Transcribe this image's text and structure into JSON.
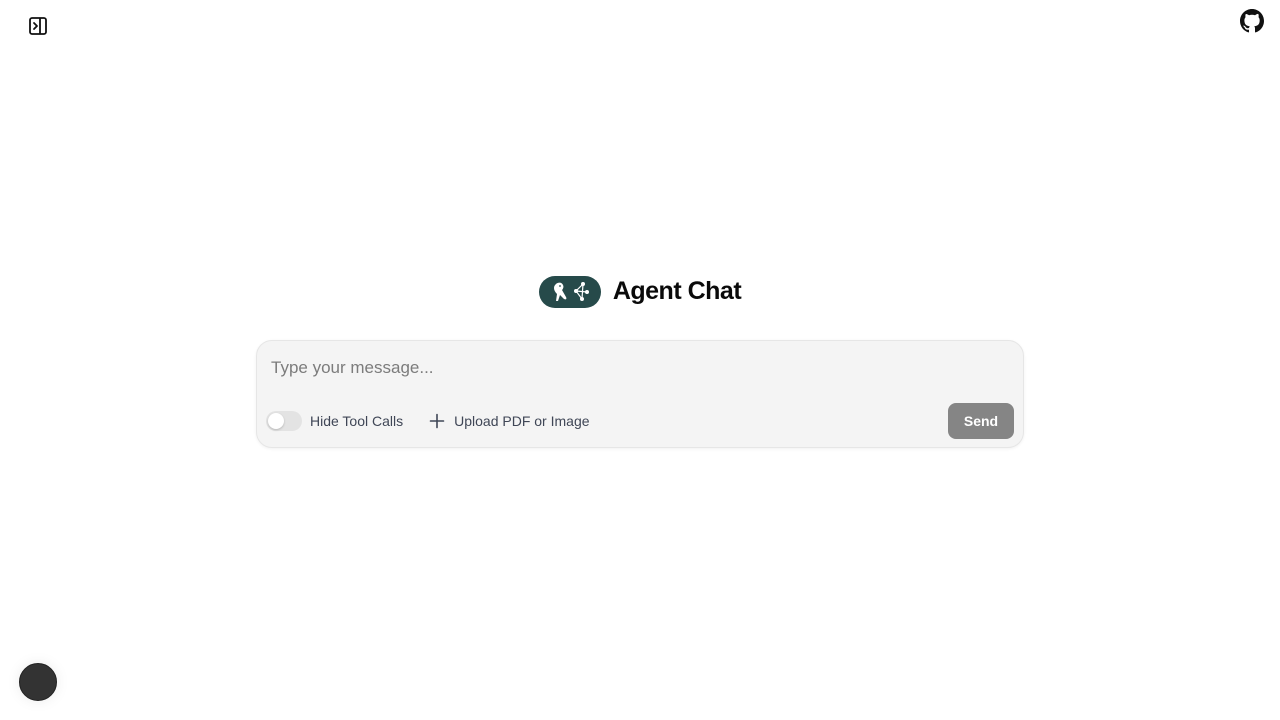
{
  "header": {
    "sidebar_toggle_icon": "sidebar-expand-icon",
    "github_icon": "github-icon"
  },
  "brand": {
    "logo_icon": "langgraph-logo-icon",
    "logo_color": "#264a4a",
    "title": "Agent Chat"
  },
  "composer": {
    "placeholder": "Type your message...",
    "value": "",
    "hide_tool_calls": {
      "label": "Hide Tool Calls",
      "enabled": false
    },
    "upload": {
      "icon": "plus-icon",
      "label": "Upload PDF or Image"
    },
    "send_label": "Send",
    "send_color": "#858585"
  },
  "footer": {
    "avatar_color": "#333333"
  }
}
